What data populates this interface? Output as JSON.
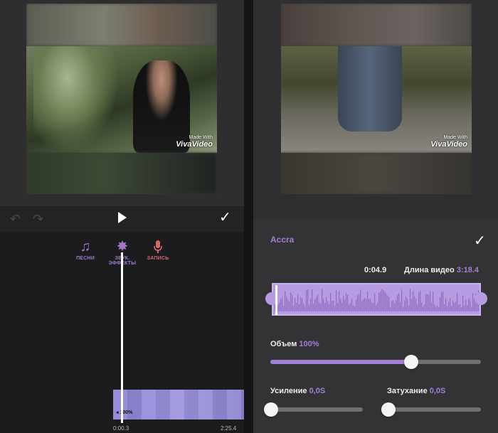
{
  "left": {
    "watermark": {
      "small": "Made With",
      "big": "VivaVideo"
    },
    "tools": [
      {
        "label": "ПЕСНИ",
        "icon": "music-add-icon"
      },
      {
        "label": "ЗВУК. ЭФФЕКТЫ",
        "icon": "sparkle-icon"
      },
      {
        "label": "ЗАПИСЬ",
        "icon": "microphone-icon"
      }
    ],
    "track": {
      "volume": "100%"
    },
    "time_start": "0:00.3",
    "time_end": "2:25.4"
  },
  "right": {
    "watermark": {
      "small": "Made With",
      "big": "VivaVideo"
    },
    "song_title": "Accra",
    "current_time": "0:04.9",
    "length_label": "Длина видео",
    "length_value": "3:18.4",
    "volume": {
      "label": "Объем",
      "value": "100%",
      "level": 0.67
    },
    "gain": {
      "label": "Усиление",
      "value": "0,0S",
      "level": 0
    },
    "fade": {
      "label": "Затухание",
      "value": "0,0S",
      "level": 0
    }
  },
  "colors": {
    "accent": "#a07fd6",
    "record": "#d36b6b",
    "track": "#9d94df"
  }
}
